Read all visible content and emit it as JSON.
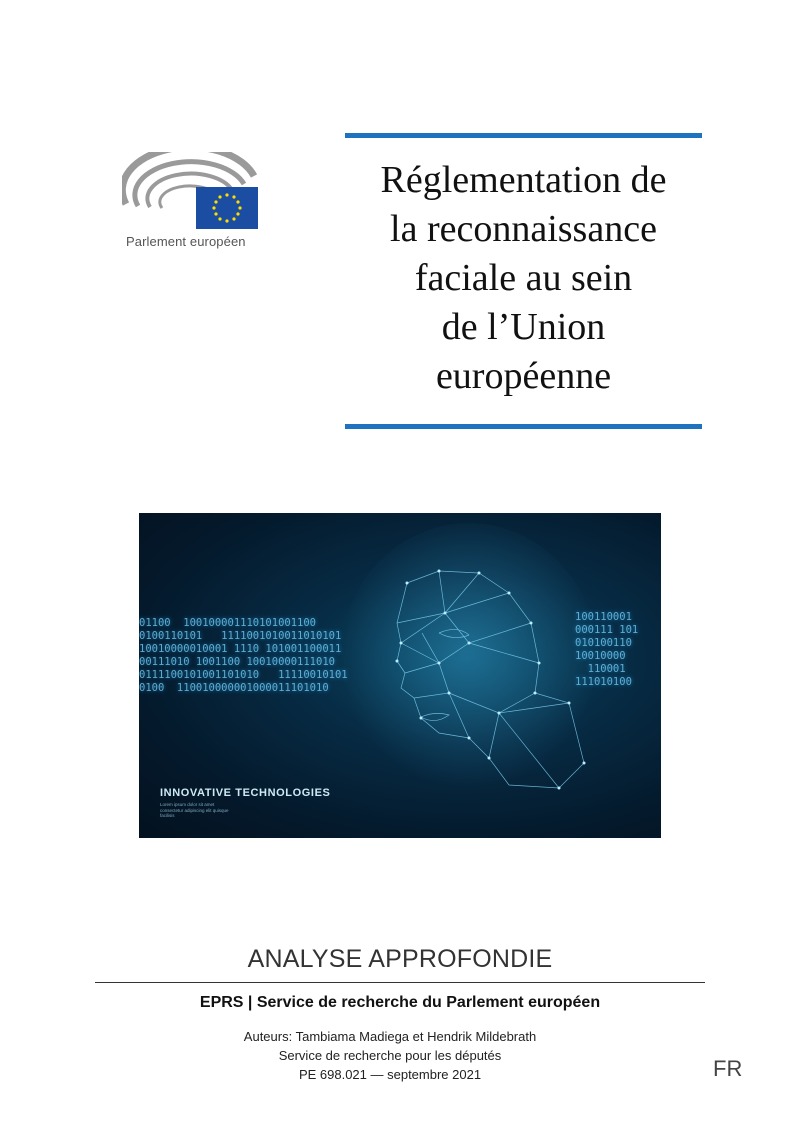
{
  "logo": {
    "icon": "european-parliament-logo",
    "text": "Parlement européen",
    "flag_color": "#1b4ea3",
    "star_color": "#ffdd00"
  },
  "title": {
    "lines": [
      "Réglementation de",
      "la reconnaissance",
      "faciale au sein",
      "de l’Union",
      "européenne"
    ],
    "rule_color": "#1e72c0"
  },
  "cover_image": {
    "caption": "INNOVATIVE TECHNOLOGIES",
    "subcaption": "Lorem ipsum dolor sit amet consectetur adipiscing elit quisque facilisis",
    "binary_left": "01100  100100001110101001100\n0100110101   1111001010011010101\n10010000010001 1110 101001100011\n00111010 1001100 10010000111010\n0111100101001101010   11110010101\n0100  110010000001000011101010",
    "binary_right": "100110001\n000111 101\n010100110\n10010000\n  110001\n111010100"
  },
  "footer": {
    "doc_type": "ANALYSE APPROFONDIE",
    "publisher": "EPRS | Service de recherche du Parlement européen",
    "authors": "Auteurs: Tambiama Madiega et Hendrik Mildebrath",
    "service": "Service de recherche pour les députés",
    "reference": "PE 698.021 — septembre 2021",
    "language": "FR"
  }
}
